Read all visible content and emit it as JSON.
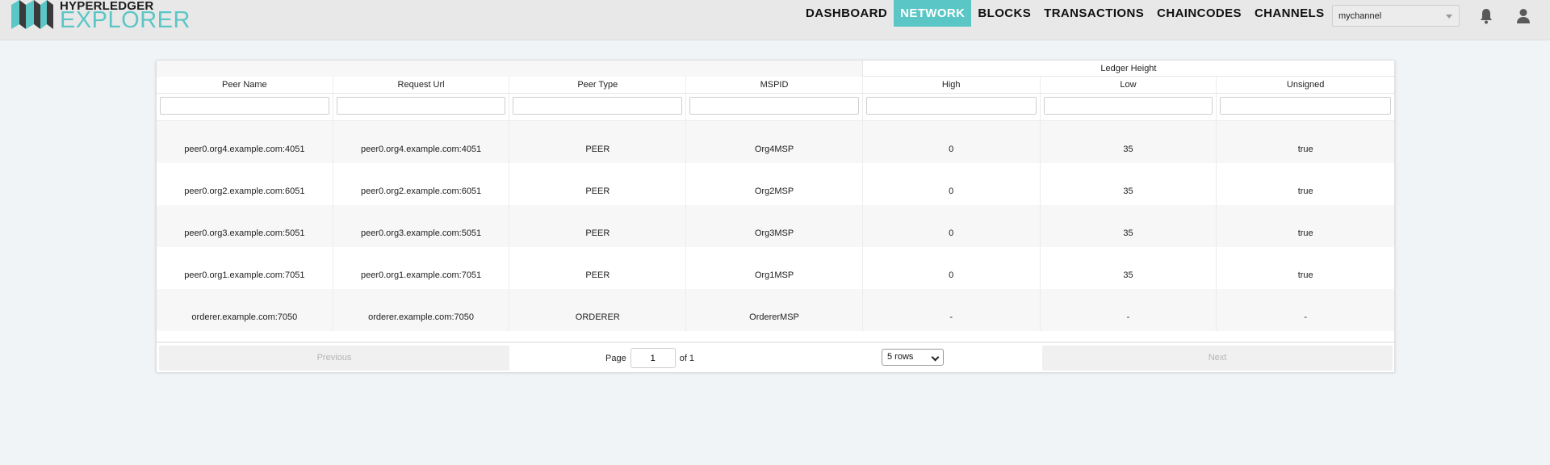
{
  "app": {
    "logo_top": "HYPERLEDGER",
    "logo_bottom": "EXPLORER",
    "accent": "#5bc6c6"
  },
  "nav": {
    "items": [
      {
        "label": "DASHBOARD",
        "active": false
      },
      {
        "label": "NETWORK",
        "active": true
      },
      {
        "label": "BLOCKS",
        "active": false
      },
      {
        "label": "TRANSACTIONS",
        "active": false
      },
      {
        "label": "CHAINCODES",
        "active": false
      },
      {
        "label": "CHANNELS",
        "active": false
      }
    ]
  },
  "channel_select": {
    "value": "mychannel"
  },
  "icons": {
    "notifications": "bell-icon",
    "user": "user-icon"
  },
  "table": {
    "group_header": "Ledger Height",
    "columns": [
      "Peer Name",
      "Request Url",
      "Peer Type",
      "MSPID",
      "High",
      "Low",
      "Unsigned"
    ],
    "rows": [
      [
        "peer0.org4.example.com:4051",
        "peer0.org4.example.com:4051",
        "PEER",
        "Org4MSP",
        "0",
        "35",
        "true"
      ],
      [
        "peer0.org2.example.com:6051",
        "peer0.org2.example.com:6051",
        "PEER",
        "Org2MSP",
        "0",
        "35",
        "true"
      ],
      [
        "peer0.org3.example.com:5051",
        "peer0.org3.example.com:5051",
        "PEER",
        "Org3MSP",
        "0",
        "35",
        "true"
      ],
      [
        "peer0.org1.example.com:7051",
        "peer0.org1.example.com:7051",
        "PEER",
        "Org1MSP",
        "0",
        "35",
        "true"
      ],
      [
        "orderer.example.com:7050",
        "orderer.example.com:7050",
        "ORDERER",
        "OrdererMSP",
        "-",
        "-",
        "-"
      ]
    ]
  },
  "pagination": {
    "previous": "Previous",
    "page_label": "Page",
    "page_value": "1",
    "of_label": "of 1",
    "rows_option": "5 rows",
    "next": "Next"
  }
}
